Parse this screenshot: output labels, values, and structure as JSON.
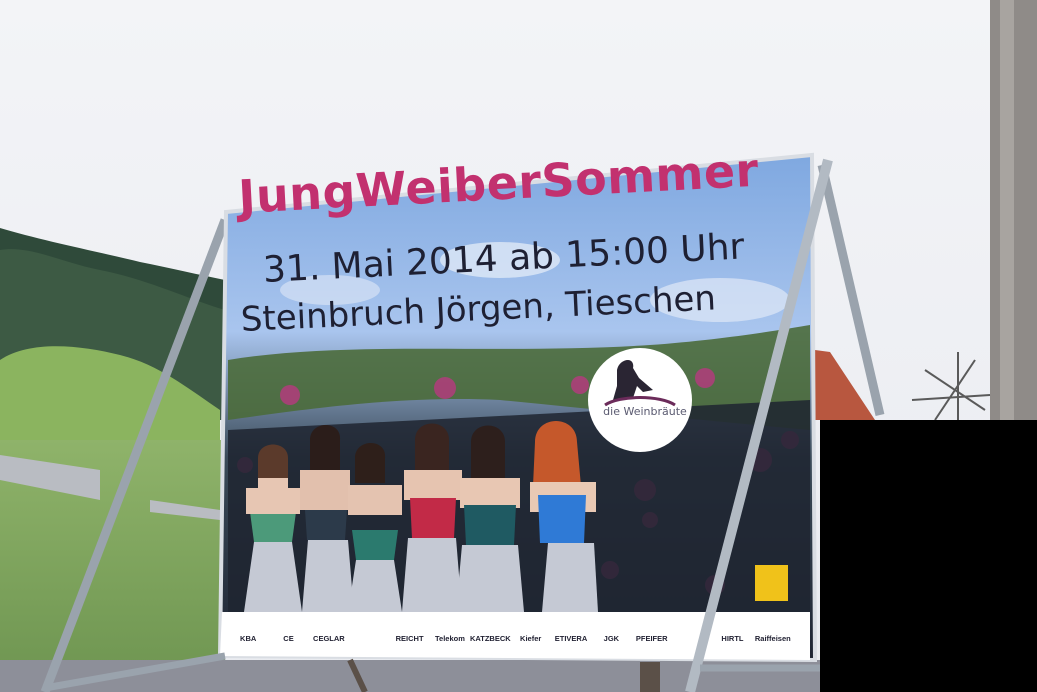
{
  "sign": {
    "title": "JungWeiberSommer",
    "date_line": "31. Mai 2014 ab 15:00 Uhr",
    "location_line": "Steinbruch Jörgen, Tieschen",
    "logo_caption": "die Weinbräute"
  },
  "sponsors": [
    "KBA",
    "CE",
    "CEGLAR",
    "",
    "REICHT",
    "Telekom",
    "KATZBECK",
    "Kiefer",
    "ETIVERA",
    "JGK",
    "PFEIFER",
    "",
    "HIRTL",
    "Raiffeisen"
  ],
  "colors": {
    "sky": "#eef0f4",
    "title": "#c2316f",
    "text": "#1e2033",
    "frame": "#9aa3ad",
    "black_box": "#000000"
  }
}
